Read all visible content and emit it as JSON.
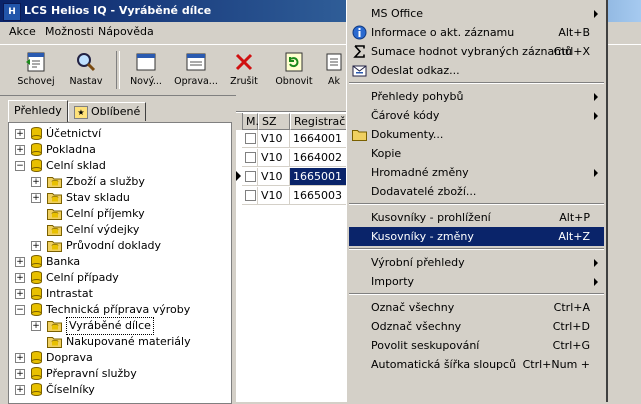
{
  "window": {
    "title": "LCS Helios IQ - Vyráběné dílce",
    "app_icon_text": "H"
  },
  "menubar": [
    "Akce",
    "Možnosti",
    "Nápověda"
  ],
  "toolbar": [
    {
      "label": "Schovej",
      "icon": "hide-panel-icon"
    },
    {
      "label": "Nastav",
      "icon": "search-icon"
    },
    {
      "label": "Nový...",
      "icon": "new-record-icon"
    },
    {
      "label": "Oprava...",
      "icon": "edit-form-icon"
    },
    {
      "label": "Zrušit",
      "icon": "delete-x-icon"
    },
    {
      "label": "Obnovit",
      "icon": "refresh-icon"
    },
    {
      "label": "Ak",
      "icon": "actions-icon"
    }
  ],
  "tabs": [
    {
      "label": "Přehledy"
    },
    {
      "label": "Oblíbené"
    }
  ],
  "tree": [
    {
      "label": "Účetnictví",
      "level": 0,
      "expander": "+",
      "icon": "database"
    },
    {
      "label": "Pokladna",
      "level": 0,
      "expander": "+",
      "icon": "database"
    },
    {
      "label": "Celní sklad",
      "level": 0,
      "expander": "−",
      "icon": "database"
    },
    {
      "label": "Zboží a služby",
      "level": 1,
      "expander": "+",
      "icon": "folder-db"
    },
    {
      "label": "Stav skladu",
      "level": 1,
      "expander": "+",
      "icon": "folder-db"
    },
    {
      "label": "Celní příjemky",
      "level": 1,
      "expander": "",
      "icon": "folder-db"
    },
    {
      "label": "Celní výdejky",
      "level": 1,
      "expander": "",
      "icon": "folder-db"
    },
    {
      "label": "Průvodní doklady",
      "level": 1,
      "expander": "+",
      "icon": "folder-db"
    },
    {
      "label": "Banka",
      "level": 0,
      "expander": "+",
      "icon": "database"
    },
    {
      "label": "Celní případy",
      "level": 0,
      "expander": "+",
      "icon": "database"
    },
    {
      "label": "Intrastat",
      "level": 0,
      "expander": "+",
      "icon": "database"
    },
    {
      "label": "Technická příprava výroby",
      "level": 0,
      "expander": "−",
      "icon": "database"
    },
    {
      "label": "Vyráběné dílce",
      "level": 1,
      "expander": "+",
      "icon": "folder-db",
      "selected": true
    },
    {
      "label": "Nakupované materiály",
      "level": 1,
      "expander": "",
      "icon": "folder-db"
    },
    {
      "label": "Doprava",
      "level": 0,
      "expander": "+",
      "icon": "database"
    },
    {
      "label": "Přepravní služby",
      "level": 0,
      "expander": "+",
      "icon": "database"
    },
    {
      "label": "Číselníky",
      "level": 0,
      "expander": "+",
      "icon": "database"
    }
  ],
  "grid": {
    "columns": [
      "M.",
      "SZ",
      "Registrač."
    ],
    "rows": [
      {
        "sz": "V10",
        "reg": "1664001",
        "selected": false
      },
      {
        "sz": "V10",
        "reg": "1664002",
        "selected": false
      },
      {
        "sz": "V10",
        "reg": "1665001",
        "selected": true
      },
      {
        "sz": "V10",
        "reg": "1665003",
        "selected": false
      }
    ]
  },
  "context_menu": [
    {
      "label": "MS Office",
      "shortcut": "",
      "submenu": true,
      "icon": ""
    },
    {
      "label": "Informace o akt. záznamu",
      "shortcut": "Alt+B",
      "submenu": false,
      "icon": "info-icon"
    },
    {
      "label": "Sumace hodnot vybraných záznamů",
      "shortcut": "Ctrl+X",
      "submenu": false,
      "icon": "sigma-icon"
    },
    {
      "label": "Odeslat odkaz...",
      "shortcut": "",
      "submenu": false,
      "icon": "send-link-icon"
    },
    {
      "sep": true
    },
    {
      "label": "Přehledy pohybů",
      "shortcut": "",
      "submenu": true,
      "icon": ""
    },
    {
      "label": "Čárové kódy",
      "shortcut": "",
      "submenu": true,
      "icon": ""
    },
    {
      "label": "Dokumenty...",
      "shortcut": "",
      "submenu": false,
      "icon": "folder-icon"
    },
    {
      "label": "Kopie",
      "shortcut": "",
      "submenu": false,
      "icon": ""
    },
    {
      "label": "Hromadné změny",
      "shortcut": "",
      "submenu": true,
      "icon": ""
    },
    {
      "label": "Dodavatelé zboží...",
      "shortcut": "",
      "submenu": false,
      "icon": ""
    },
    {
      "sep": true
    },
    {
      "label": "Kusovníky - prohlížení",
      "shortcut": "Alt+P",
      "submenu": false,
      "icon": ""
    },
    {
      "label": "Kusovníky - změny",
      "shortcut": "Alt+Z",
      "submenu": false,
      "icon": "",
      "selected": true
    },
    {
      "sep": true
    },
    {
      "label": "Výrobní přehledy",
      "shortcut": "",
      "submenu": true,
      "icon": ""
    },
    {
      "label": "Importy",
      "shortcut": "",
      "submenu": true,
      "icon": ""
    },
    {
      "sep": true
    },
    {
      "label": "Označ všechny",
      "shortcut": "Ctrl+A",
      "submenu": false,
      "icon": ""
    },
    {
      "label": "Odznač všechny",
      "shortcut": "Ctrl+D",
      "submenu": false,
      "icon": ""
    },
    {
      "label": "Povolit seskupování",
      "shortcut": "Ctrl+G",
      "submenu": false,
      "icon": ""
    },
    {
      "label": "Automatická šířka sloupců",
      "shortcut": "Ctrl+Num +",
      "submenu": false,
      "icon": ""
    }
  ],
  "colors": {
    "title_start": "#0a246a",
    "title_end": "#a6caf0",
    "selection": "#0a246a",
    "face": "#d4d0c8",
    "db_icon": "#e8c000"
  }
}
